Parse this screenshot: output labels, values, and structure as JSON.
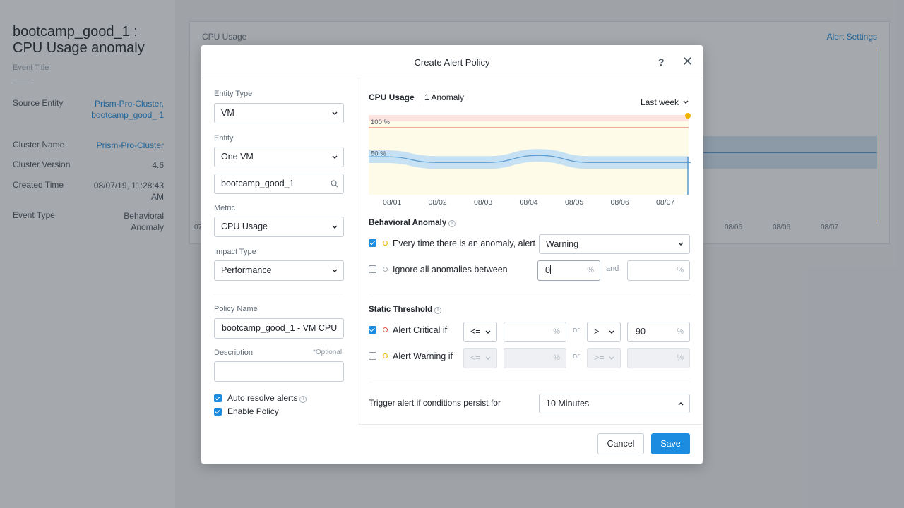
{
  "background": {
    "title": "bootcamp_good_1 : CPU Usage anomaly",
    "subtitle": "Event Title",
    "rows": [
      {
        "key": "Source Entity",
        "value": "Prism-Pro-Cluster, bootcamp_good_ 1"
      },
      {
        "key": "Cluster Name",
        "value": "Prism-Pro-Cluster"
      },
      {
        "key": "Cluster Version",
        "value": "4.6"
      },
      {
        "key": "Created Time",
        "value": "08/07/19, 11:28:43 AM"
      },
      {
        "key": "Event Type",
        "value": "Behavioral Anomaly"
      }
    ],
    "panel_title": "CPU Usage",
    "panel_link": "Alert Settings",
    "panel_ticks": [
      "08/06",
      "08/06",
      "08/07"
    ],
    "panel_tick_left": "07"
  },
  "modal": {
    "title": "Create Alert Policy",
    "help_label": "?",
    "close_label": "✕",
    "entity_type": {
      "label": "Entity Type",
      "value": "VM"
    },
    "entity": {
      "label": "Entity",
      "value": "One VM"
    },
    "entity_search": {
      "value": "bootcamp_good_1"
    },
    "metric": {
      "label": "Metric",
      "value": "CPU Usage"
    },
    "impact_type": {
      "label": "Impact Type",
      "value": "Performance"
    },
    "policy_name": {
      "label": "Policy Name",
      "value": "bootcamp_good_1 - VM CPU"
    },
    "description": {
      "label": "Description",
      "optional": "*Optional",
      "value": ""
    },
    "auto_resolve": {
      "label": "Auto resolve alerts",
      "checked": true
    },
    "enable_policy": {
      "label": "Enable Policy",
      "checked": true
    },
    "chart": {
      "title": "CPU Usage",
      "anomaly_count": "1 Anomaly",
      "range": "Last week"
    },
    "behavioral_anomaly": {
      "title": "Behavioral Anomaly",
      "every_time": {
        "label": "Every time there is an anomaly, alert",
        "checked": true,
        "severity": "Warning"
      },
      "ignore": {
        "label": "Ignore all anomalies between",
        "checked": false,
        "from": "0",
        "and_label": "and",
        "to": "",
        "unit": "%"
      }
    },
    "static_threshold": {
      "title": "Static Threshold",
      "critical": {
        "label": "Alert Critical if",
        "checked": true,
        "op1": "<=",
        "val1": "",
        "or_label": "or",
        "op2": ">",
        "val2": "90",
        "unit": "%"
      },
      "warning": {
        "label": "Alert Warning if",
        "checked": false,
        "op1": "<=",
        "val1": "",
        "or_label": "or",
        "op2": ">=",
        "val2": "",
        "unit": "%"
      }
    },
    "trigger": {
      "label": "Trigger alert if conditions persist for",
      "value": "10 Minutes"
    },
    "cancel_label": "Cancel",
    "save_label": "Save"
  },
  "chart_data": {
    "type": "area",
    "x": [
      "08/01",
      "08/02",
      "08/03",
      "08/04",
      "08/05",
      "08/06",
      "08/07"
    ],
    "y_labels": [
      "100 %",
      "50 %"
    ],
    "threshold_label": "100 %",
    "ylim": [
      0,
      100
    ],
    "series": [
      {
        "values": [
          45,
          36,
          36,
          47,
          36,
          36,
          36
        ]
      }
    ],
    "colors": {
      "critical_band": "#fde3df",
      "critical_line": "#e5534b",
      "warning_zone": "#fefbe9",
      "band": "#bcdcf5",
      "line": "#5a9bcf"
    }
  }
}
